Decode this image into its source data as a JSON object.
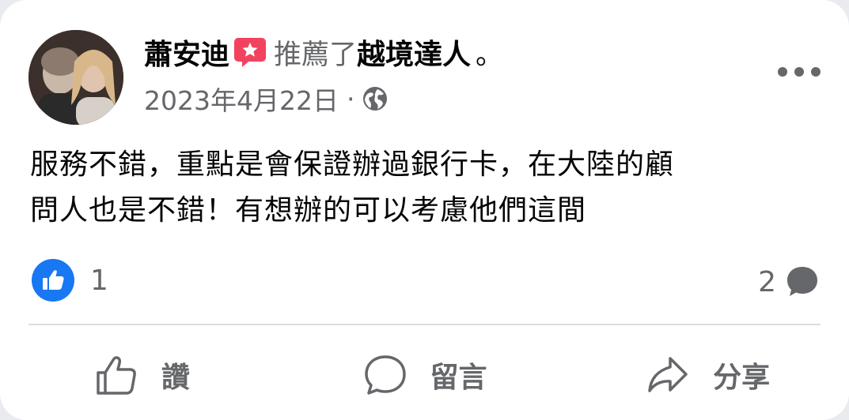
{
  "post": {
    "author": "蕭安迪",
    "verb": "推薦了",
    "page": "越境達人",
    "period": "。",
    "date": "2023年4月22日",
    "separator": "·",
    "privacy_icon": "globe-icon",
    "text_line1": "服務不錯，重點是會保證辦過銀行卡，在大陸的顧",
    "text_line2": "問人也是不錯！有想辦的可以考慮他們這間"
  },
  "reactions": {
    "like_count": "1",
    "comment_count": "2"
  },
  "actions": {
    "like_label": "讚",
    "comment_label": "留言",
    "share_label": "分享"
  },
  "colors": {
    "like_blue": "#1877f2",
    "recommend_badge": "#f3425f",
    "secondary_text": "#65676b"
  }
}
